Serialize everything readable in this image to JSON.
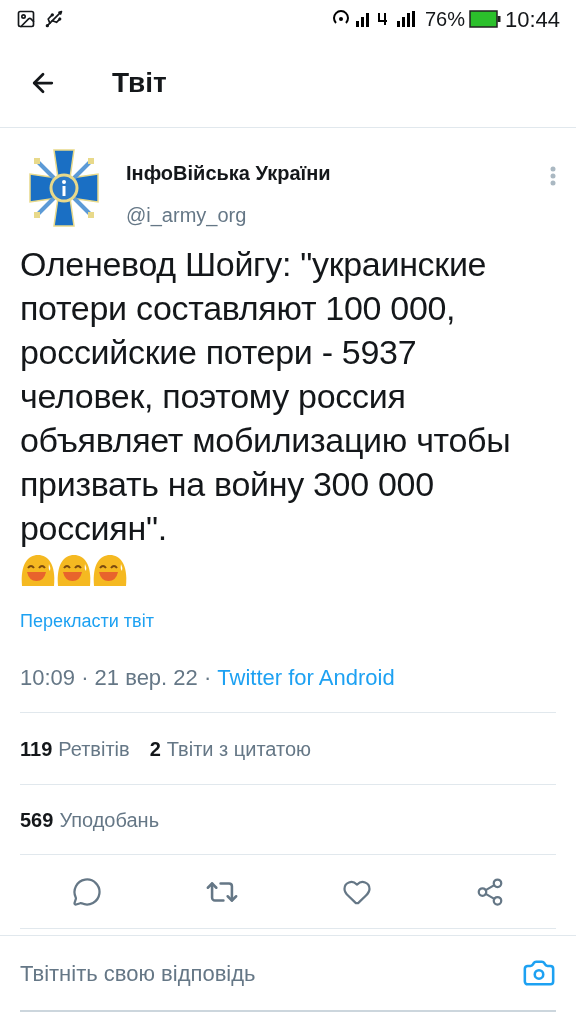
{
  "status_bar": {
    "battery": "76%",
    "time": "10:44"
  },
  "header": {
    "title": "Твіт"
  },
  "tweet": {
    "author": "ІнфоВійська України",
    "handle": "@i_army_org",
    "text": "Оленевод Шойгу: \"украинские потери составляют 100 000, российские потери - 5937 человек, поэтому россия объявляет мобилизацию чтобы призвать на войну 300 000 россиян\".",
    "translate": "Перекласти твіт",
    "time": "10:09 · 21 вер. 22 · ",
    "source": "Twitter for Android",
    "stats": [
      {
        "count": "119",
        "label": "Ретвітів"
      },
      {
        "count": "2",
        "label": "Твіти з цитатою"
      }
    ],
    "likes": {
      "count": "569",
      "label": "Уподобань"
    }
  },
  "reply": {
    "placeholder": "Твітніть свою відповідь"
  }
}
